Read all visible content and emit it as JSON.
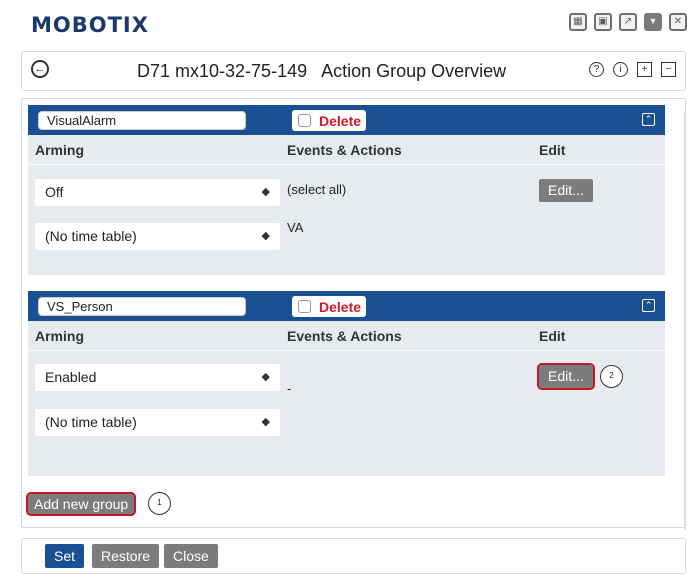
{
  "brand": "MOBOTIX",
  "top_icons": [
    "grid-view-icon",
    "window-icon",
    "open-external-icon",
    "dropdown-icon",
    "close-icon"
  ],
  "title": {
    "device": "D71 mx10-32-75-149",
    "page": "Action Group Overview"
  },
  "title_icons": [
    "help-icon",
    "info-icon",
    "expand-all-icon",
    "collapse-all-icon"
  ],
  "columns": {
    "arming": "Arming",
    "events_actions": "Events & Actions",
    "edit": "Edit"
  },
  "groups": [
    {
      "name": "VisualAlarm",
      "delete_label": "Delete",
      "arming_value": "Off",
      "time_table_value": "(No time table)",
      "events_select_all": "(select all)",
      "events_item": "VA",
      "edit_label": "Edit..."
    },
    {
      "name": "VS_Person",
      "delete_label": "Delete",
      "arming_value": "Enabled",
      "time_table_value": "(No time table)",
      "events_item": "-",
      "edit_label": "Edit...",
      "callout": "2"
    }
  ],
  "add_group_label": "Add new group",
  "add_group_callout": "1",
  "footer": {
    "set_label": "Set",
    "restore_label": "Restore",
    "close_label": "Close"
  },
  "colors": {
    "brand": "#1b3a6b",
    "group_header": "#1a4f93",
    "group_body": "#e7ebf0",
    "delete_text": "#d5182c",
    "highlight": "#c8142b",
    "button_gray": "#7c7c7c",
    "set_button": "#1a4f93"
  }
}
